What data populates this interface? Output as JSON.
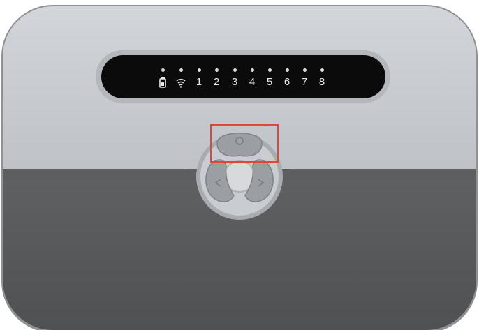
{
  "device": {
    "panel": {
      "leds": [
        {
          "id": "battery",
          "icon": "battery-icon"
        },
        {
          "id": "wifi",
          "icon": "wifi-icon"
        },
        {
          "id": "zone-1",
          "label": "1"
        },
        {
          "id": "zone-2",
          "label": "2"
        },
        {
          "id": "zone-3",
          "label": "3"
        },
        {
          "id": "zone-4",
          "label": "4"
        },
        {
          "id": "zone-5",
          "label": "5"
        },
        {
          "id": "zone-6",
          "label": "6"
        },
        {
          "id": "zone-7",
          "label": "7"
        },
        {
          "id": "zone-8",
          "label": "8"
        }
      ]
    },
    "controls": {
      "top_button_icon": "power-circle-icon",
      "left_button_icon": "left-arrow-icon",
      "right_button_icon": "right-arrow-icon"
    },
    "colors": {
      "body_top": "#c4c7cd",
      "body_bottom": "#58595b",
      "display": "#0b0b0c",
      "led_text": "#e8e8e8",
      "highlight": "#e2453c"
    }
  }
}
